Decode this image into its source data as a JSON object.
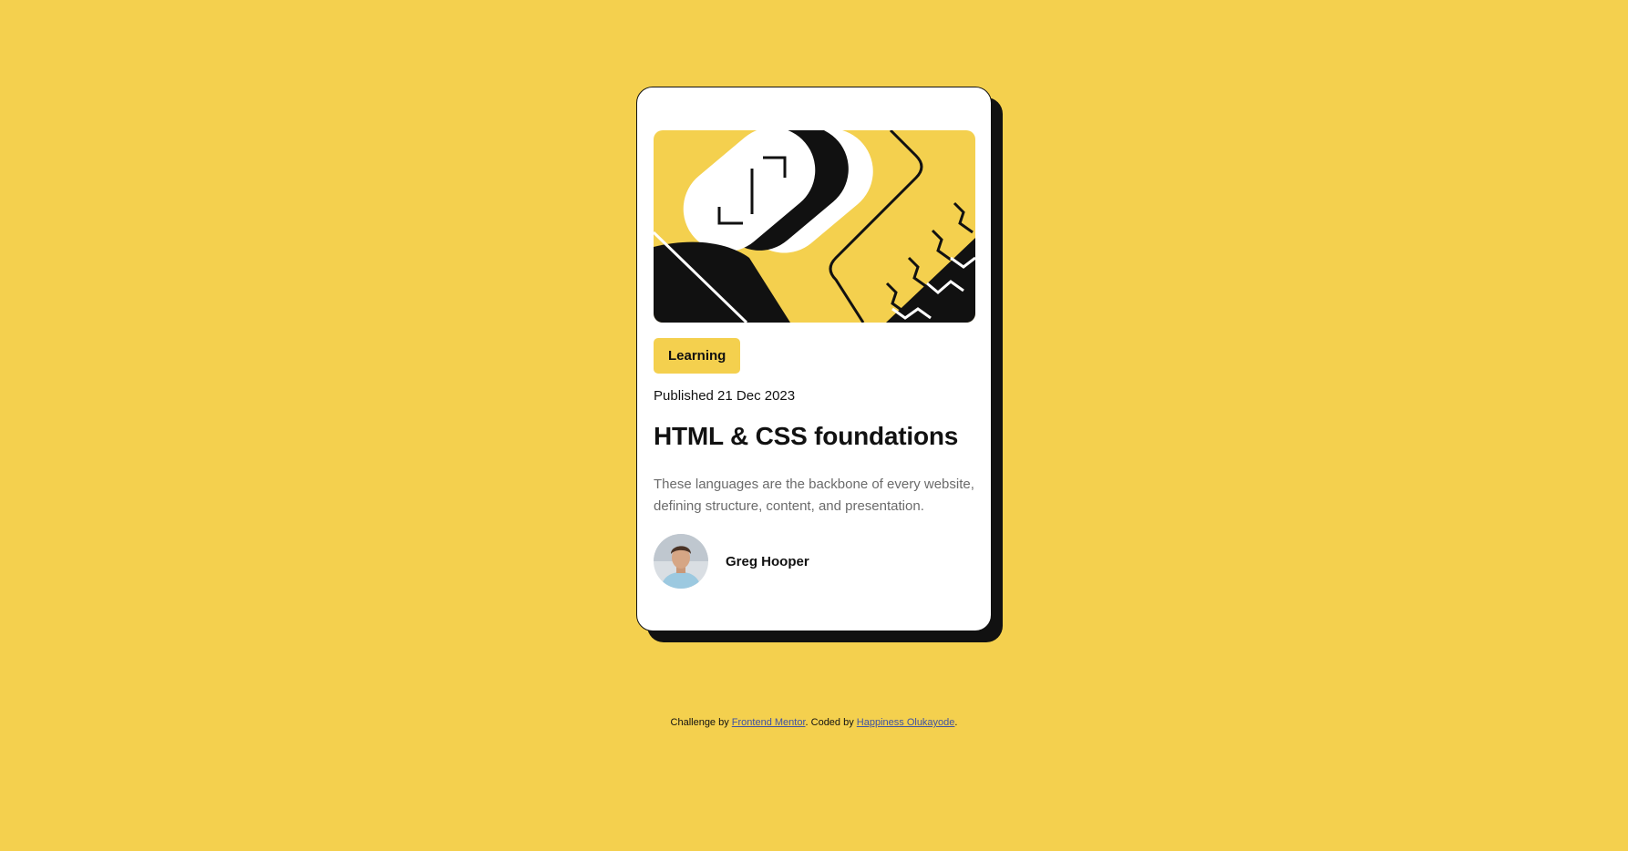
{
  "colors": {
    "background": "#F4D04E",
    "card": "#FFFFFF",
    "ink": "#111111",
    "muted_text": "#6B6B6B",
    "link": "#3E52A3"
  },
  "card": {
    "hero_image": "abstract-illustration",
    "tag": "Learning",
    "published": "Published 21 Dec 2023",
    "title": "HTML & CSS foundations",
    "description": "These languages are the backbone of every website, defining structure, content, and presentation.",
    "author": {
      "avatar": "author-avatar",
      "name": "Greg Hooper"
    }
  },
  "attribution": {
    "prefix": "Challenge by ",
    "challenge_link": "Frontend Mentor",
    "middle": ". Coded by ",
    "author_link": "Happiness Olukayode",
    "suffix": "."
  }
}
